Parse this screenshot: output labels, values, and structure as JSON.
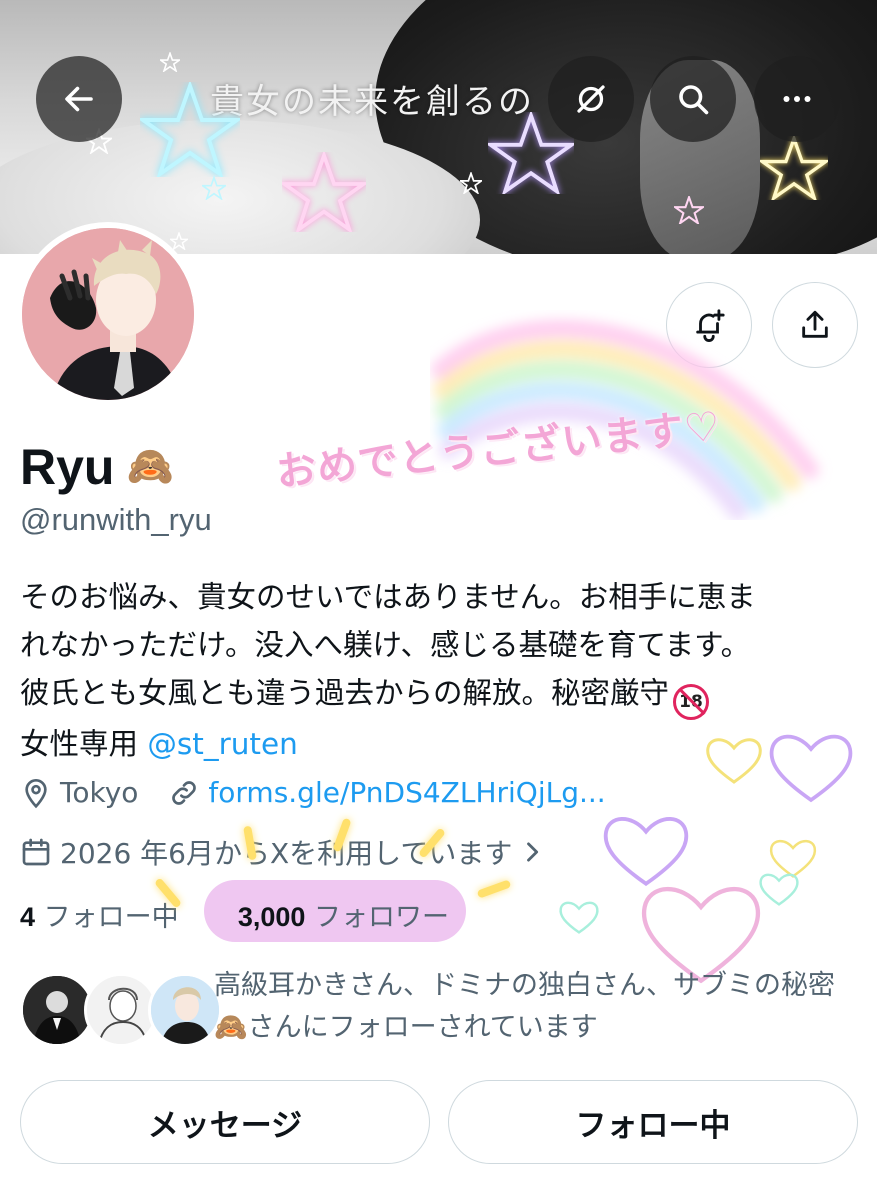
{
  "header": {
    "banner_text": "貴女の未来を創るの",
    "back_icon": "arrow-left-icon",
    "grok_icon": "grok-icon",
    "search_icon": "search-icon",
    "more_icon": "more-horizontal-icon"
  },
  "profile": {
    "display_name": "Ryu",
    "name_emoji": "🙈",
    "handle": "@runwith_ryu",
    "bio": {
      "line1": "そのお悩み、貴女のせいではありません。お相手に恵ま",
      "line2": "れなかっただけ。没入へ躾け、感じる基礎を育てます。",
      "line3": "彼氏とも女風とも違う過去からの解放。秘密厳守",
      "badge_18": "18",
      "line4_prefix": "女性専用 ",
      "mention": "@st_ruten"
    },
    "location": "Tokyo",
    "link": "forms.gle/PnDS4ZLHriQjLg...",
    "joined": "2026 年6月からXを利用しています",
    "following_count": "4",
    "following_label": "フォロー中",
    "followers_count": "3,000",
    "followers_label": "フォロワー",
    "followed_by_text": "高級耳かきさん、ドミナの独白さん、サブミの秘密🙈さんにフォローされています"
  },
  "overlay": {
    "congrats_text": "おめでとうございます♡"
  },
  "actions": {
    "message_label": "メッセージ",
    "following_button_label": "フォロー中",
    "notify_icon": "bell-plus-icon",
    "share_icon": "share-icon"
  },
  "colors": {
    "link_blue": "#1d9bf0",
    "secondary_text": "#536471",
    "highlight_pink": "#efc7f1",
    "congrats_pink": "#f3a6d6"
  }
}
